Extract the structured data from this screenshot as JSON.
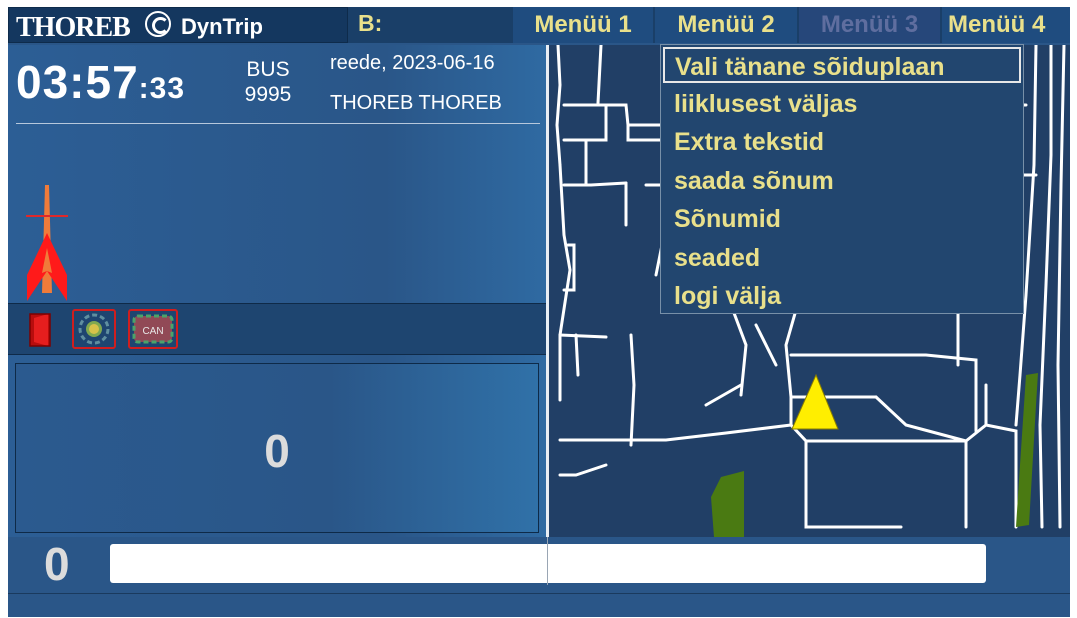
{
  "app": {
    "logo_text": "THOREB",
    "product": "DynTrip",
    "route_prefix": "B:"
  },
  "menus": [
    {
      "label": "Menüü 1",
      "enabled": true
    },
    {
      "label": "Menüü 2",
      "enabled": true,
      "open": true
    },
    {
      "label": "Menüü 3",
      "enabled": false
    },
    {
      "label": "Menüü 4",
      "enabled": true
    }
  ],
  "dropdown": {
    "selected_index": 0,
    "items": [
      {
        "label": "Vali tänane sõiduplaan"
      },
      {
        "label": "liiklusest väljas"
      },
      {
        "label": "Extra tekstid"
      },
      {
        "label": "saada sõnum"
      },
      {
        "label": "Sõnumid"
      },
      {
        "label": "seaded"
      },
      {
        "label": "logi välja"
      }
    ]
  },
  "status": {
    "time_hm": "03:57",
    "time_sec": ":33",
    "bus_label": "BUS",
    "bus_number": "9995",
    "date": "reede, 2023-06-16",
    "driver": "THOREB THOREB"
  },
  "indicators": [
    {
      "name": "door-icon",
      "state": "open"
    },
    {
      "name": "gps-status-icon",
      "state": "error"
    },
    {
      "name": "can-status-icon",
      "label": "CAN",
      "state": "error"
    }
  ],
  "counter": {
    "value": "0"
  },
  "bottom": {
    "count": "0",
    "message": ""
  },
  "colors": {
    "menu_text": "#e9e08b",
    "menu_disabled": "#5f6e9f",
    "panel_bg": "#2a5688",
    "map_bg": "#213f66",
    "road": "#ffffff",
    "park": "#4a7a12",
    "vehicle_marker": "#ffee00",
    "heading_arrow": "#ff1a1a"
  }
}
